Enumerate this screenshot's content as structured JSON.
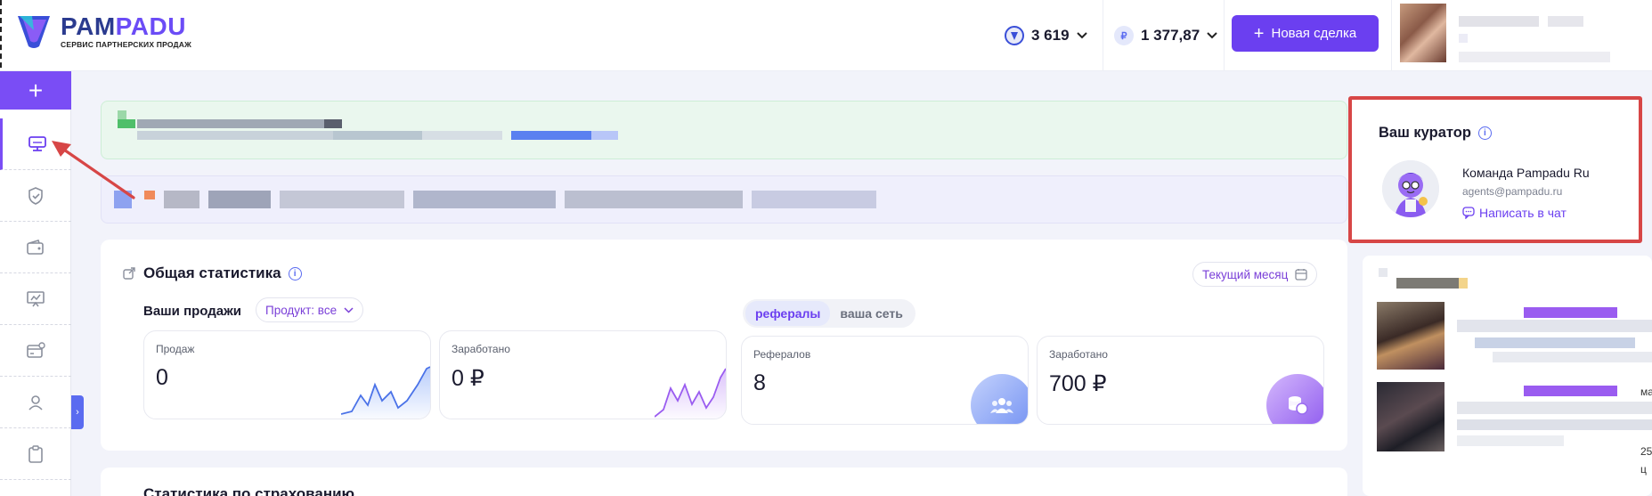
{
  "brand": {
    "name_a": "PAM",
    "name_b": "PADU",
    "subtitle": "СЕРВИС ПАРТНЕРСКИХ ПРОДАЖ",
    "logo_icon": "pampadu-logo-icon"
  },
  "header": {
    "points_value": "3 619",
    "points_icon": "shield-coin-icon",
    "balance_currency": "₽",
    "balance_value": "1 377,87",
    "new_deal_label": "Новая сделка",
    "accent": "#6b3ff0"
  },
  "sidebar": {
    "add_label": "+",
    "items": [
      {
        "icon": "dashboard-monitor-icon",
        "active": true
      },
      {
        "icon": "shield-check-icon"
      },
      {
        "icon": "wallet-icon"
      },
      {
        "icon": "presentation-chart-icon"
      },
      {
        "icon": "card-id-icon"
      },
      {
        "icon": "user-icon"
      },
      {
        "icon": "clipboard-icon"
      }
    ],
    "toggle_label": "›"
  },
  "stats": {
    "title": "Общая статистика",
    "period_label": "Текущий месяц",
    "sales_label": "Ваши продажи",
    "product_filter": "Продукт: все",
    "segment": {
      "tabs": [
        "рефералы",
        "ваша сеть"
      ],
      "active_index": 0
    },
    "cards": [
      {
        "label": "Продаж",
        "value": "0"
      },
      {
        "label": "Заработано",
        "value": "0 ₽"
      },
      {
        "label": "Рефералов",
        "value": "8"
      },
      {
        "label": "Заработано",
        "value": "700 ₽"
      }
    ],
    "second_title": "Статистика по страхованию"
  },
  "curator": {
    "title": "Ваш куратор",
    "name": "Команда Pampadu Ru",
    "email": "agents@pampadu.ru",
    "chat_label": "Написать в чат",
    "highlight": "#d74646"
  },
  "feed_edge": {
    "t1": "ма",
    "t2": "25",
    "t3": "ц"
  }
}
